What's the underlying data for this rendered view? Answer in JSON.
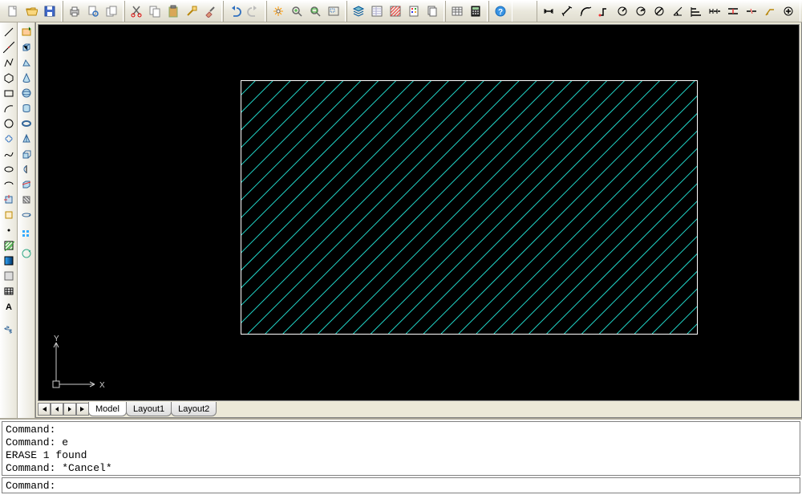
{
  "toolbar_top": {
    "file_icons": [
      "new",
      "open",
      "save",
      "",
      "print",
      "print-preview",
      "publish",
      "",
      "cut",
      "copy",
      "paste",
      "match",
      "paintbrush",
      "",
      "undo",
      "redo"
    ],
    "view_icons": [
      "pan",
      "zoom-in",
      "zoom-extents",
      "",
      "layers",
      "properties",
      "hatch",
      "tool-palette",
      "",
      "table",
      "calculator",
      "",
      "help"
    ],
    "snap_icons": [
      "dim-linear",
      "dim-aligned",
      "dim-arc",
      "dim-ordinate",
      "dim-radius",
      "dim-diameter",
      "dim-angular",
      "dim-baseline",
      "dim-continue",
      "dim-edit",
      "dim-style",
      "dim-update",
      "qleader",
      "dim-center"
    ]
  },
  "left_tools1": [
    "line",
    "construction-line",
    "polyline",
    "polygon",
    "rectangle",
    "arc",
    "circle",
    "revcloud",
    "spline",
    "ellipse",
    "ellipse-arc",
    "insert-block",
    "make-block",
    "point",
    "hatch",
    "gradient",
    "region",
    "table-tool",
    "text-tool"
  ],
  "left_tools2": [
    "layer-new",
    "box",
    "wedge",
    "cone",
    "sphere",
    "cylinder",
    "torus",
    "pyramid",
    "extrude",
    "revolve",
    "slice",
    "section",
    "rotate3d",
    "",
    "array3d",
    "",
    "3dface",
    "ucs"
  ],
  "tabs": {
    "active": "Model",
    "items": [
      "Model",
      "Layout1",
      "Layout2"
    ]
  },
  "command_history": [
    "Command:",
    "Command: e",
    "ERASE 1 found",
    "Command: *Cancel*"
  ],
  "command_prompt": "Command:",
  "ucs": {
    "x_label": "X",
    "y_label": "Y"
  },
  "colors": {
    "hatch": "#21d5c8",
    "rect_border": "#ffffff"
  }
}
